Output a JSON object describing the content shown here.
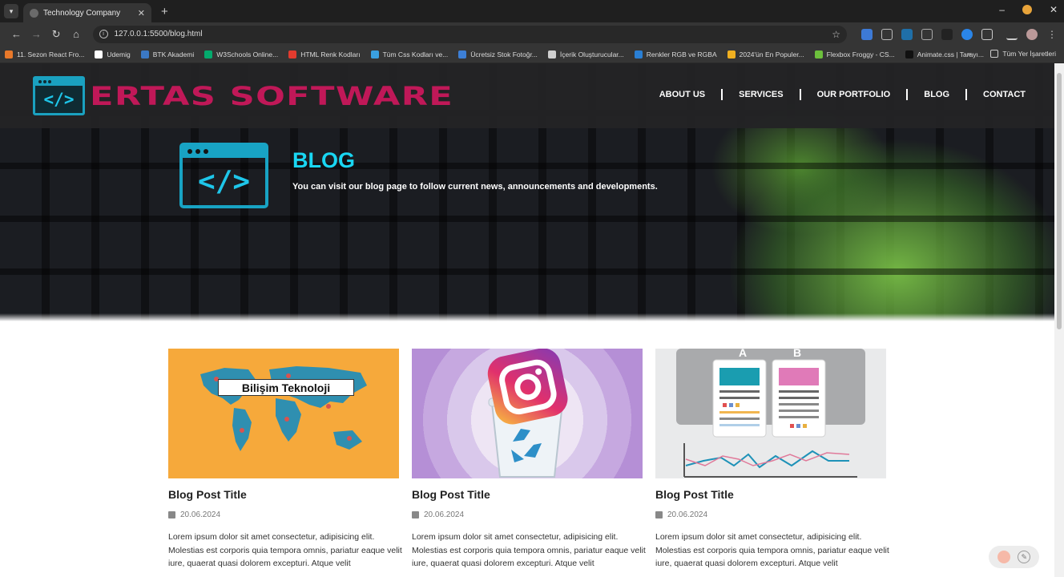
{
  "browser": {
    "tab_title": "Technology Company",
    "tab_close": "✕",
    "new_tab": "+",
    "url": "127.0.0.1:5500/blog.html",
    "window_controls": [
      "–",
      "✕"
    ],
    "bookmarks": [
      {
        "label": "11. Sezon React Fro...",
        "color": "#e8782a"
      },
      {
        "label": "Udemig",
        "color": "#ffffff"
      },
      {
        "label": "BTK Akademi",
        "color": "#3b78c4"
      },
      {
        "label": "W3Schools Online...",
        "color": "#04aa6d"
      },
      {
        "label": "HTML Renk Kodları",
        "color": "#e33b2e"
      },
      {
        "label": "Tüm Css Kodları ve...",
        "color": "#3aa0e0"
      },
      {
        "label": "Ücretsiz Stok Fotoğr...",
        "color": "#3d7fd6"
      },
      {
        "label": "İçerik Oluşturucular...",
        "color": "#cfcfcf"
      },
      {
        "label": "Renkler RGB ve RGBA",
        "color": "#2a7fd4"
      },
      {
        "label": "2024'ün En Populer...",
        "color": "#f0b020"
      },
      {
        "label": "Flexbox Froggy - CS...",
        "color": "#6cbf3c"
      },
      {
        "label": "Animate.css | Tarayı...",
        "color": "#111111"
      }
    ],
    "bookmarks_overflow": "»",
    "all_bookmarks": "Tüm Yer İşaretleri"
  },
  "site": {
    "logo_text": "ERTAS SOFTWARE",
    "logo_code": "</>",
    "nav": [
      "ABOUT US",
      "SERVICES",
      "OUR PORTFOLIO",
      "BLOG",
      "CONTACT"
    ],
    "hero": {
      "title": "BLOG",
      "subtitle": "You can visit our blog page to follow current news, announcements and developments."
    },
    "cards": [
      {
        "image_label": "Bilişim Teknoloji",
        "title": "Blog Post Title",
        "date": "20.06.2024",
        "text": "Lorem ipsum dolor sit amet consectetur, adipisicing elit. Molestias est corporis quia tempora omnis, pariatur eaque velit iure, quaerat quasi dolorem excepturi. Atque velit"
      },
      {
        "image_label": "",
        "title": "Blog Post Title",
        "date": "20.06.2024",
        "text": "Lorem ipsum dolor sit amet consectetur, adipisicing elit. Molestias est corporis quia tempora omnis, pariatur eaque velit iure, quaerat quasi dolorem excepturi. Atque velit"
      },
      {
        "image_label": "",
        "image_letters": [
          "A",
          "B"
        ],
        "title": "Blog Post Title",
        "date": "20.06.2024",
        "text": "Lorem ipsum dolor sit amet consectetur, adipisicing elit. Molestias est corporis quia tempora omnis, pariatur eaque velit iure, quaerat quasi dolorem excepturi. Atque velit"
      }
    ]
  },
  "colors": {
    "accent_cyan": "#19d6f2",
    "logo_magenta": "#c01858",
    "header_bg": "#232325"
  },
  "icons": {
    "calendar": "calendar-icon",
    "back": "arrow-left-icon",
    "forward": "arrow-right-icon",
    "reload": "reload-icon",
    "home": "home-icon",
    "star": "star-icon"
  }
}
